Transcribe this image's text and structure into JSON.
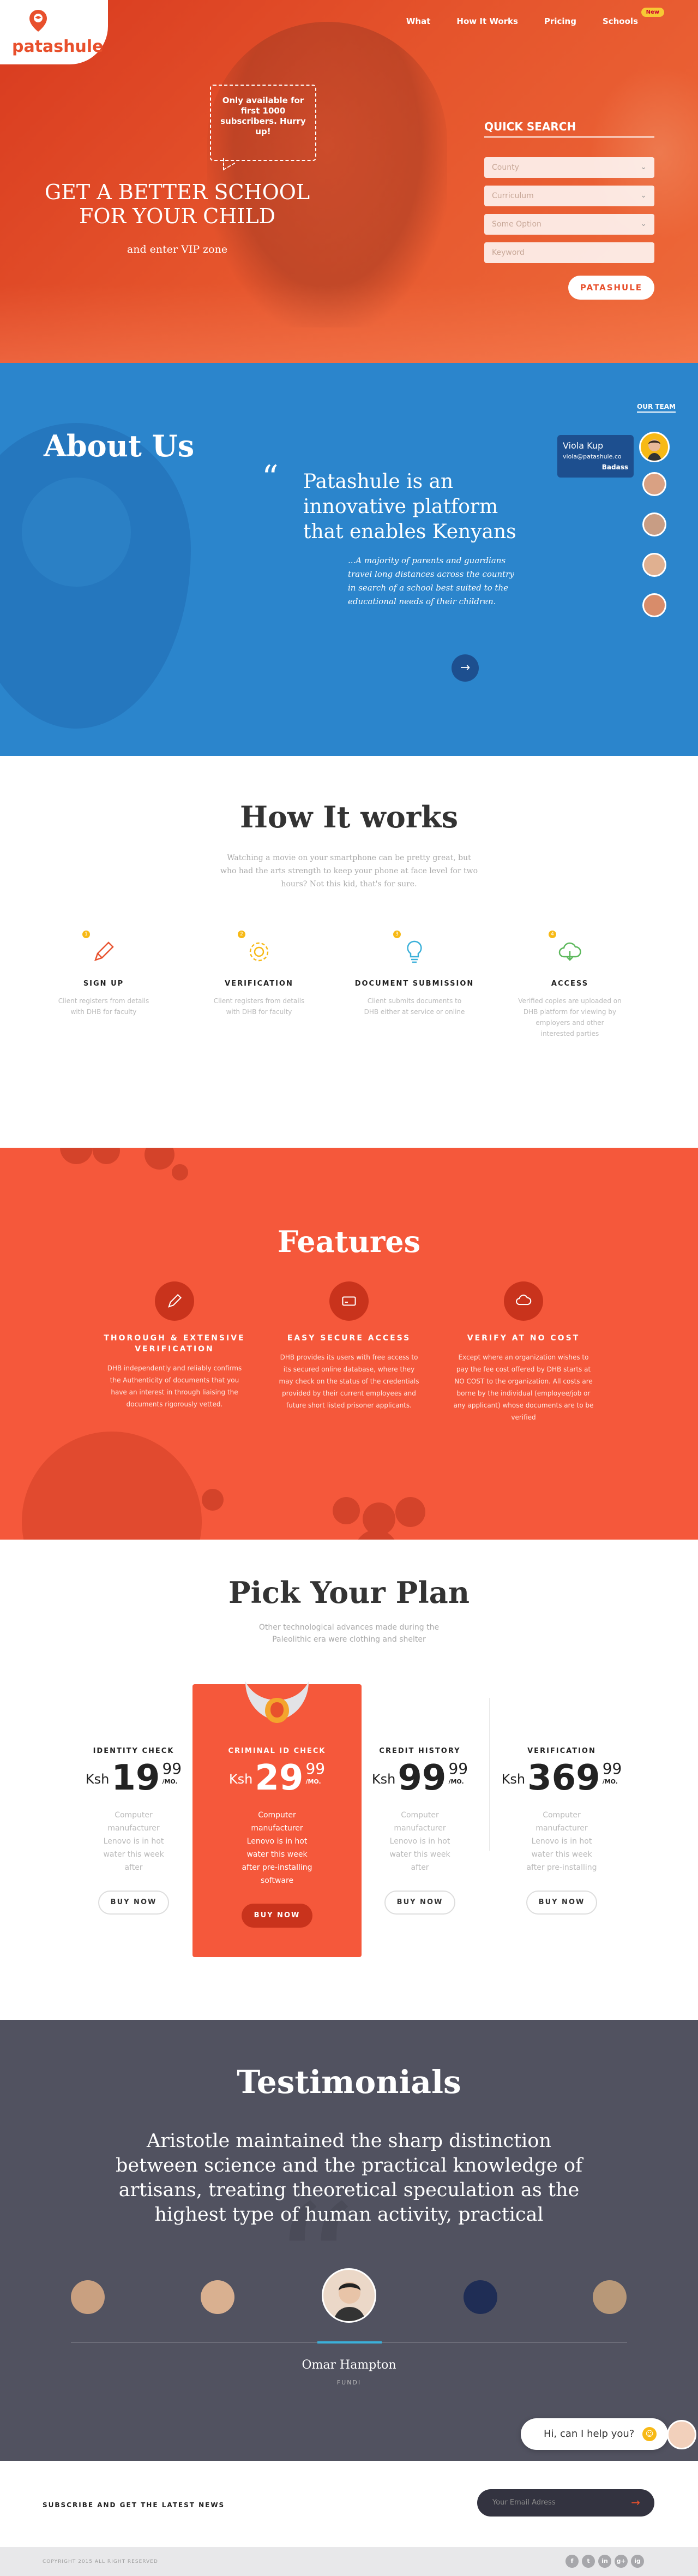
{
  "brand": {
    "name": "patashule",
    "accent": "#e8502c",
    "blue": "#2b85cc",
    "dark": "#515260"
  },
  "nav": {
    "items": [
      "What",
      "How It Works",
      "Pricing",
      "Schools"
    ],
    "badge": "New"
  },
  "hero": {
    "speech": "Only available for first 1000 subscribers. Hurry up!",
    "title": "GET A BETTER SCHOOL FOR YOUR CHILD",
    "subtitle": "and enter VIP zone",
    "search": {
      "title": "QUICK SEARCH",
      "fields": [
        "County",
        "Curriculum",
        "Some Option",
        "Keyword"
      ],
      "button": "PATASHULE"
    }
  },
  "about": {
    "title": "About Us",
    "lead": "Patashule is an innovative platform that enables Kenyans",
    "body": "...A majority of parents and guardians travel long distances across the country in search of a school best suited to the educational needs of their children.",
    "team_label": "OUR TEAM",
    "member": {
      "name": "Viola Kup",
      "email": "viola@patashule.co",
      "role": "Badass"
    }
  },
  "how": {
    "title": "How It works",
    "desc": "Watching a movie on your smartphone can be pretty great, but who had the arts strength to keep your phone at face level for two hours? Not this kid, that's for sure.",
    "steps": [
      {
        "num": "1",
        "title": "SIGN UP",
        "desc": "Client registers from details with DHB for faculty",
        "icon": "pencil-icon",
        "color": "#e8502c"
      },
      {
        "num": "2",
        "title": "VERIFICATION",
        "desc": "Client registers from details with DHB for faculty",
        "icon": "gear-icon",
        "color": "#f7b916"
      },
      {
        "num": "3",
        "title": "DOCUMENT SUBMISSION",
        "desc": "Client submits documents to DHB either at service or online",
        "icon": "bulb-icon",
        "color": "#3bb0d9"
      },
      {
        "num": "4",
        "title": "ACCESS",
        "desc": "Verified copies are uploaded on DHB platform for viewing by employers and other interested parties",
        "icon": "cloud-icon",
        "color": "#5cb85c"
      }
    ]
  },
  "features": {
    "title": "Features",
    "items": [
      {
        "title": "THOROUGH & EXTENSIVE VERIFICATION",
        "desc": "DHB independently and reliably confirms the Authenticity of documents that you have an interest in through liaising the documents rigorously vetted.",
        "icon": "pencil-icon"
      },
      {
        "title": "EASY SECURE ACCESS",
        "desc": "DHB provides its users with free access to its secured online database, where they may check on the status of the credentials provided by their current employees and future short listed prisoner applicants.",
        "icon": "card-icon"
      },
      {
        "title": "VERIFY AT NO COST",
        "desc": "Except where an organization wishes to pay the fee cost offered by DHB starts at NO COST to the organization. All costs are borne by the individual (employee/job or any applicant) whose documents are to be verified",
        "icon": "cloud-icon"
      }
    ]
  },
  "plans": {
    "title": "Pick Your Plan",
    "desc": "Other technological advances made during the Paleolithic era were clothing and shelter",
    "currency": "Ksh",
    "per": "/MO.",
    "items": [
      {
        "title": "IDENTITY CHECK",
        "whole": "19",
        "cents": "99",
        "desc": "Computer manufacturer Lenovo is in hot water this week after",
        "button": "BUY NOW"
      },
      {
        "title": "CRIMINAL ID CHECK",
        "whole": "29",
        "cents": "99",
        "desc": "Computer manufacturer Lenovo is in hot water this week after pre-installing software",
        "button": "BUY NOW"
      },
      {
        "title": "CREDIT HISTORY",
        "whole": "99",
        "cents": "99",
        "desc": "Computer manufacturer Lenovo is in hot water this week after",
        "button": "BUY NOW"
      },
      {
        "title": "VERIFICATION",
        "whole": "369",
        "cents": "99",
        "desc": "Computer manufacturer Lenovo is in hot water this week after pre-installing",
        "button": "BUY NOW"
      }
    ]
  },
  "testimonials": {
    "title": "Testimonials",
    "quote": "Aristotle maintained the sharp distinction between science and the practical knowledge of artisans, treating theoretical speculation as the highest type of human activity, practical",
    "name": "Omar Hampton",
    "role": "FUNDI",
    "chat": "Hi, can I help you?"
  },
  "subscribe": {
    "title": "SUBSCRIBE AND GET THE LATEST NEWS",
    "placeholder": "Your Email Adress"
  },
  "footer": {
    "copyright": "COPYRIGHT 2015 ALL RIGHT RESERVED",
    "social": [
      "f",
      "t",
      "in",
      "g+",
      "ig"
    ]
  }
}
